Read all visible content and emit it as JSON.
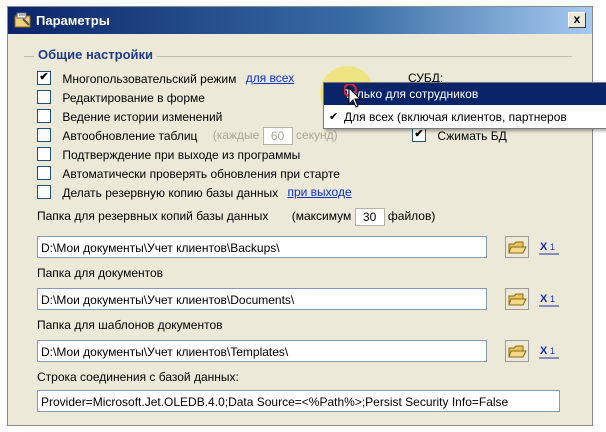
{
  "window": {
    "title": "Параметры",
    "close_label": "x"
  },
  "group": {
    "title": "Общие настройки"
  },
  "options": {
    "multiuser": {
      "label": "Многопользовательский режим",
      "checked": true,
      "link": "для всех"
    },
    "ghost_text": "СУБД:",
    "edit_in_form": {
      "label": "Редактирование в форме",
      "checked": false
    },
    "history": {
      "label": "Ведение истории изменений",
      "checked": false
    },
    "autoupdate": {
      "label": "Автообновление таблиц",
      "checked": false,
      "every_label": "(каждые",
      "every_value": "60",
      "every_unit": "секунд)"
    },
    "compress_db": {
      "label": "Сжимать БД",
      "checked": true
    },
    "confirm_exit": {
      "label": "Подтверждение при выходе из программы",
      "checked": false
    },
    "check_updates": {
      "label": "Автоматически проверять обновления при старте",
      "checked": false
    },
    "backup": {
      "label": "Делать резервную копию базы данных",
      "checked": false,
      "link": "при выходе"
    }
  },
  "backup_folder": {
    "label": "Папка для резервных копий базы данных",
    "max_label": "(максимум",
    "max_value": "30",
    "max_unit": "файлов)",
    "value": "D:\\Мои документы\\Учет клиентов\\Backups\\"
  },
  "docs_folder": {
    "label": "Папка для документов",
    "value": "D:\\Мои документы\\Учет клиентов\\Documents\\"
  },
  "templates_folder": {
    "label": "Папка для шаблонов документов",
    "value": "D:\\Мои документы\\Учет клиентов\\Templates\\"
  },
  "connection": {
    "label": "Строка соединения с базой данных:",
    "value": "Provider=Microsoft.Jet.OLEDB.4.0;Data Source=<%Path%>;Persist Security Info=False"
  },
  "dropdown": {
    "items": [
      {
        "label": "Только для сотрудников",
        "selected": true
      },
      {
        "label": "Для всех (включая клиентов, партнеров",
        "checked": true
      }
    ]
  },
  "colors": {
    "titlebar": "#0a246a",
    "link": "#0b2fd0",
    "selection": "#0a246a",
    "group_title": "#1d3c8a"
  }
}
